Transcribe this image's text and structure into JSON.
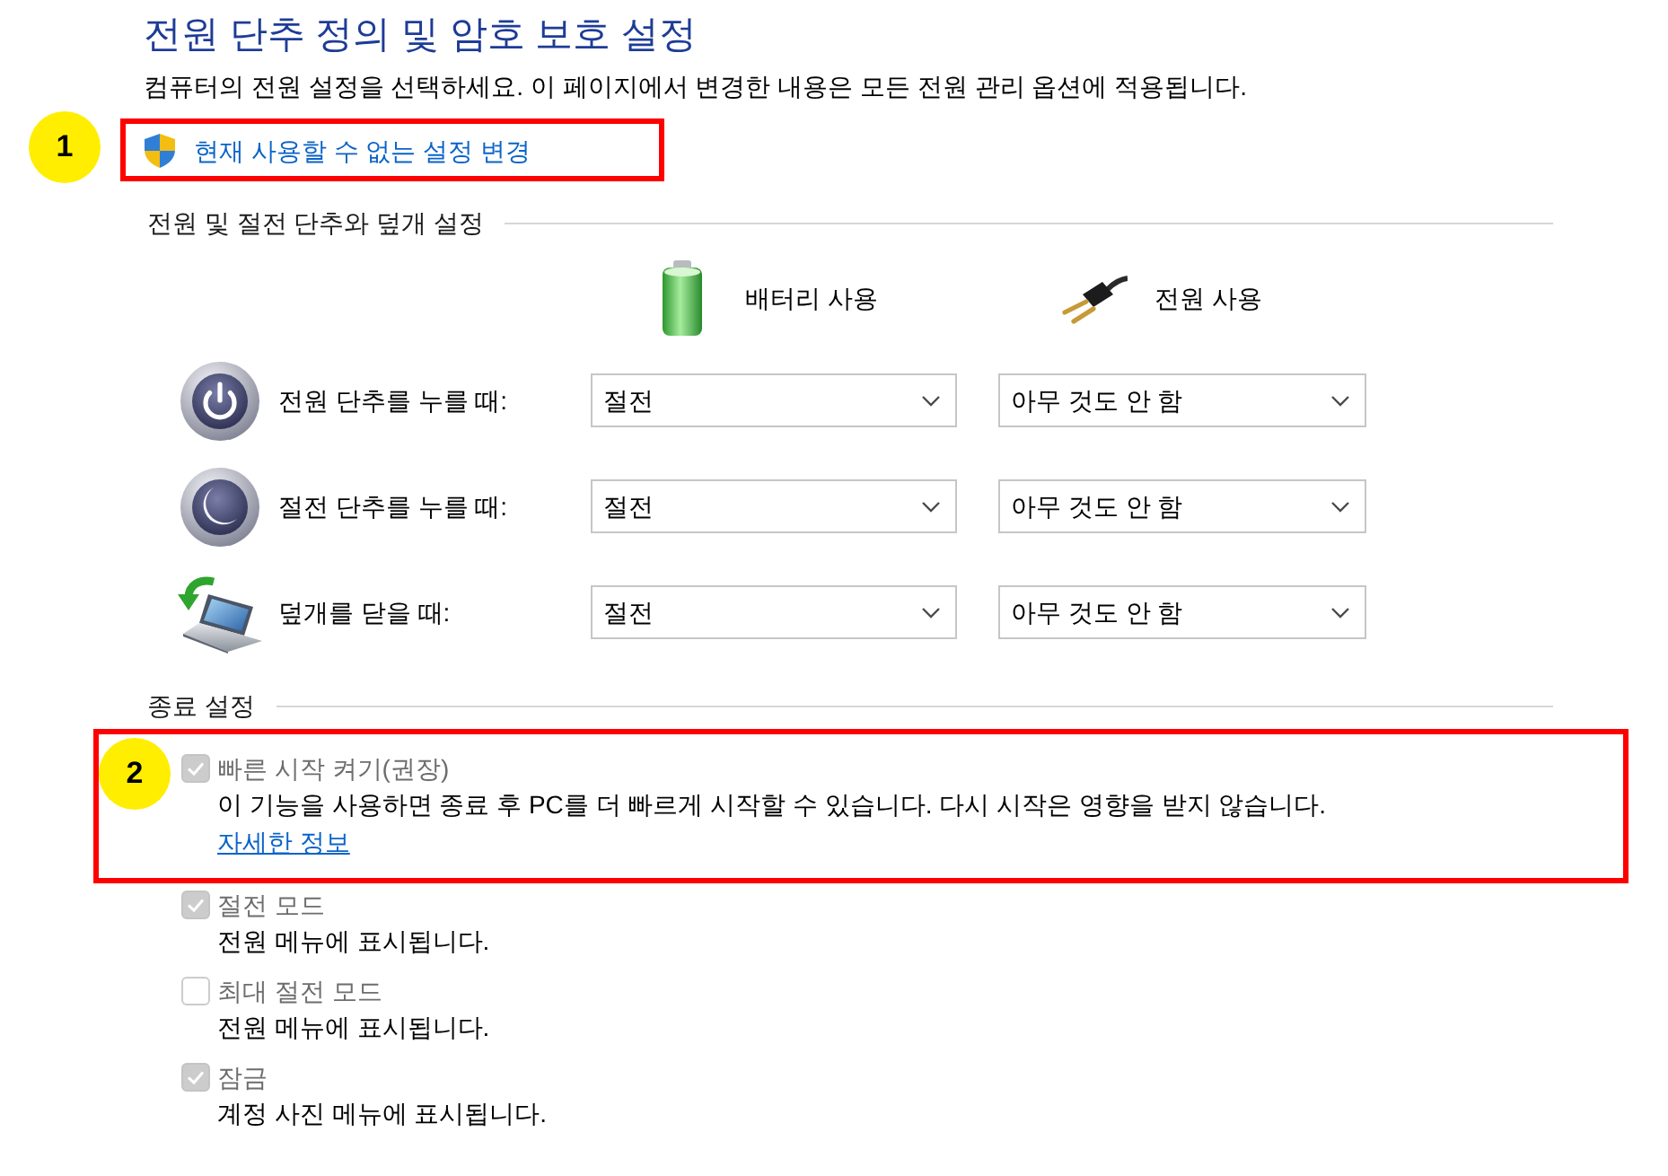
{
  "title": "전원 단추 정의 및 암호 보호 설정",
  "intro": "컴퓨터의 전원 설정을 선택하세요. 이 페이지에서 변경한 내용은 모든 전원 관리 옵션에 적용됩니다.",
  "admin_link": {
    "text": "현재 사용할 수 없는 설정 변경",
    "callout": "1"
  },
  "button_settings": {
    "heading": "전원 및 절전 단추와 덮개 설정",
    "columns": [
      {
        "kind": "battery",
        "label": "배터리 사용"
      },
      {
        "kind": "plugged_in",
        "label": "전원 사용"
      }
    ],
    "rows": [
      {
        "kind": "power_button",
        "label": "전원 단추를 누를 때:",
        "values": [
          "절전",
          "아무 것도 안 함"
        ]
      },
      {
        "kind": "sleep_button",
        "label": "절전 단추를 누를 때:",
        "values": [
          "절전",
          "아무 것도 안 함"
        ]
      },
      {
        "kind": "lid",
        "label": "덮개를 닫을 때:",
        "values": [
          "절전",
          "아무 것도 안 함"
        ]
      }
    ]
  },
  "shutdown_settings": {
    "heading": "종료 설정",
    "options": [
      {
        "label": "빠른 시작 켜기(권장)",
        "checked": true,
        "disabled": true,
        "description": "이 기능을 사용하면 종료 후 PC를 더 빠르게 시작할 수 있습니다. 다시 시작은 영향을 받지 않습니다.",
        "link": "자세한 정보",
        "callout": "2"
      },
      {
        "label": "절전 모드",
        "checked": true,
        "disabled": true,
        "description": "전원 메뉴에 표시됩니다."
      },
      {
        "label": "최대 절전 모드",
        "checked": false,
        "disabled": true,
        "description": "전원 메뉴에 표시됩니다."
      },
      {
        "label": "잠금",
        "checked": true,
        "disabled": true,
        "description": "계정 사진 메뉴에 표시됩니다."
      }
    ]
  }
}
